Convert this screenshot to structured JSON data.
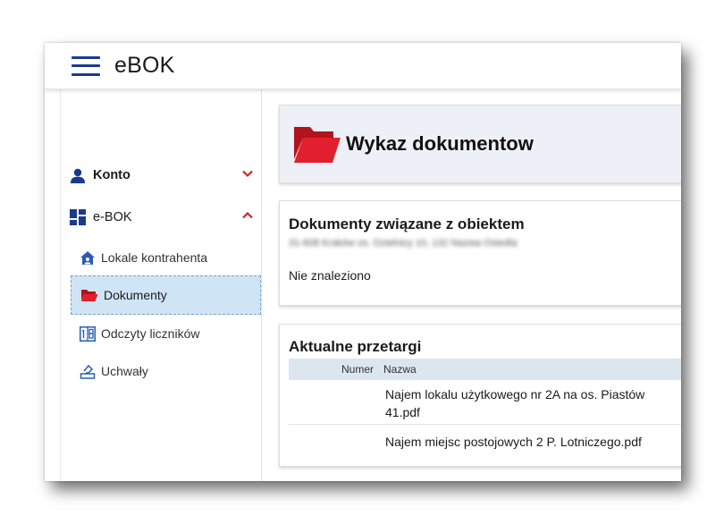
{
  "header": {
    "app_title": "eBOK",
    "menu_icon": "hamburger-icon"
  },
  "sidebar": {
    "groups": [
      {
        "label": "Konto",
        "icon": "user-icon",
        "expanded": false
      },
      {
        "label": "e-BOK",
        "icon": "dashboard-icon",
        "expanded": true
      }
    ],
    "items": [
      {
        "label": "Lokale kontrahenta",
        "icon": "home-icon",
        "active": false
      },
      {
        "label": "Dokumenty",
        "icon": "folder-open-icon",
        "active": true
      },
      {
        "label": "Odczyty liczników",
        "icon": "counter-icon",
        "active": false
      },
      {
        "label": "Uchwały",
        "icon": "vote-icon",
        "active": false
      }
    ]
  },
  "main": {
    "page_title": "Wykaz dokumentow",
    "documents": {
      "title": "Dokumenty związane z obiektem",
      "address": "31-608 Kraków os. Dzielnicy 10, 132 Nazwa Osiedla",
      "empty_text": "Nie znaleziono"
    },
    "tenders": {
      "title": "Aktualne przetargi",
      "columns": [
        "Numer",
        "Nazwa"
      ],
      "rows": [
        {
          "number": "",
          "name": "Najem lokalu użytkowego nr 2A na os. Piastów 41.pdf"
        },
        {
          "number": "",
          "name": "Najem miejsc postojowych 2 P. Lotniczego.pdf"
        }
      ]
    }
  },
  "colors": {
    "accent_blue": "#1b3a8c",
    "folder_red": "#d81e2b",
    "chevron_red": "#c62828",
    "active_bg": "#cfe5f6",
    "header_card_bg": "#edf1f7",
    "table_header_bg": "#dbe6ef"
  }
}
